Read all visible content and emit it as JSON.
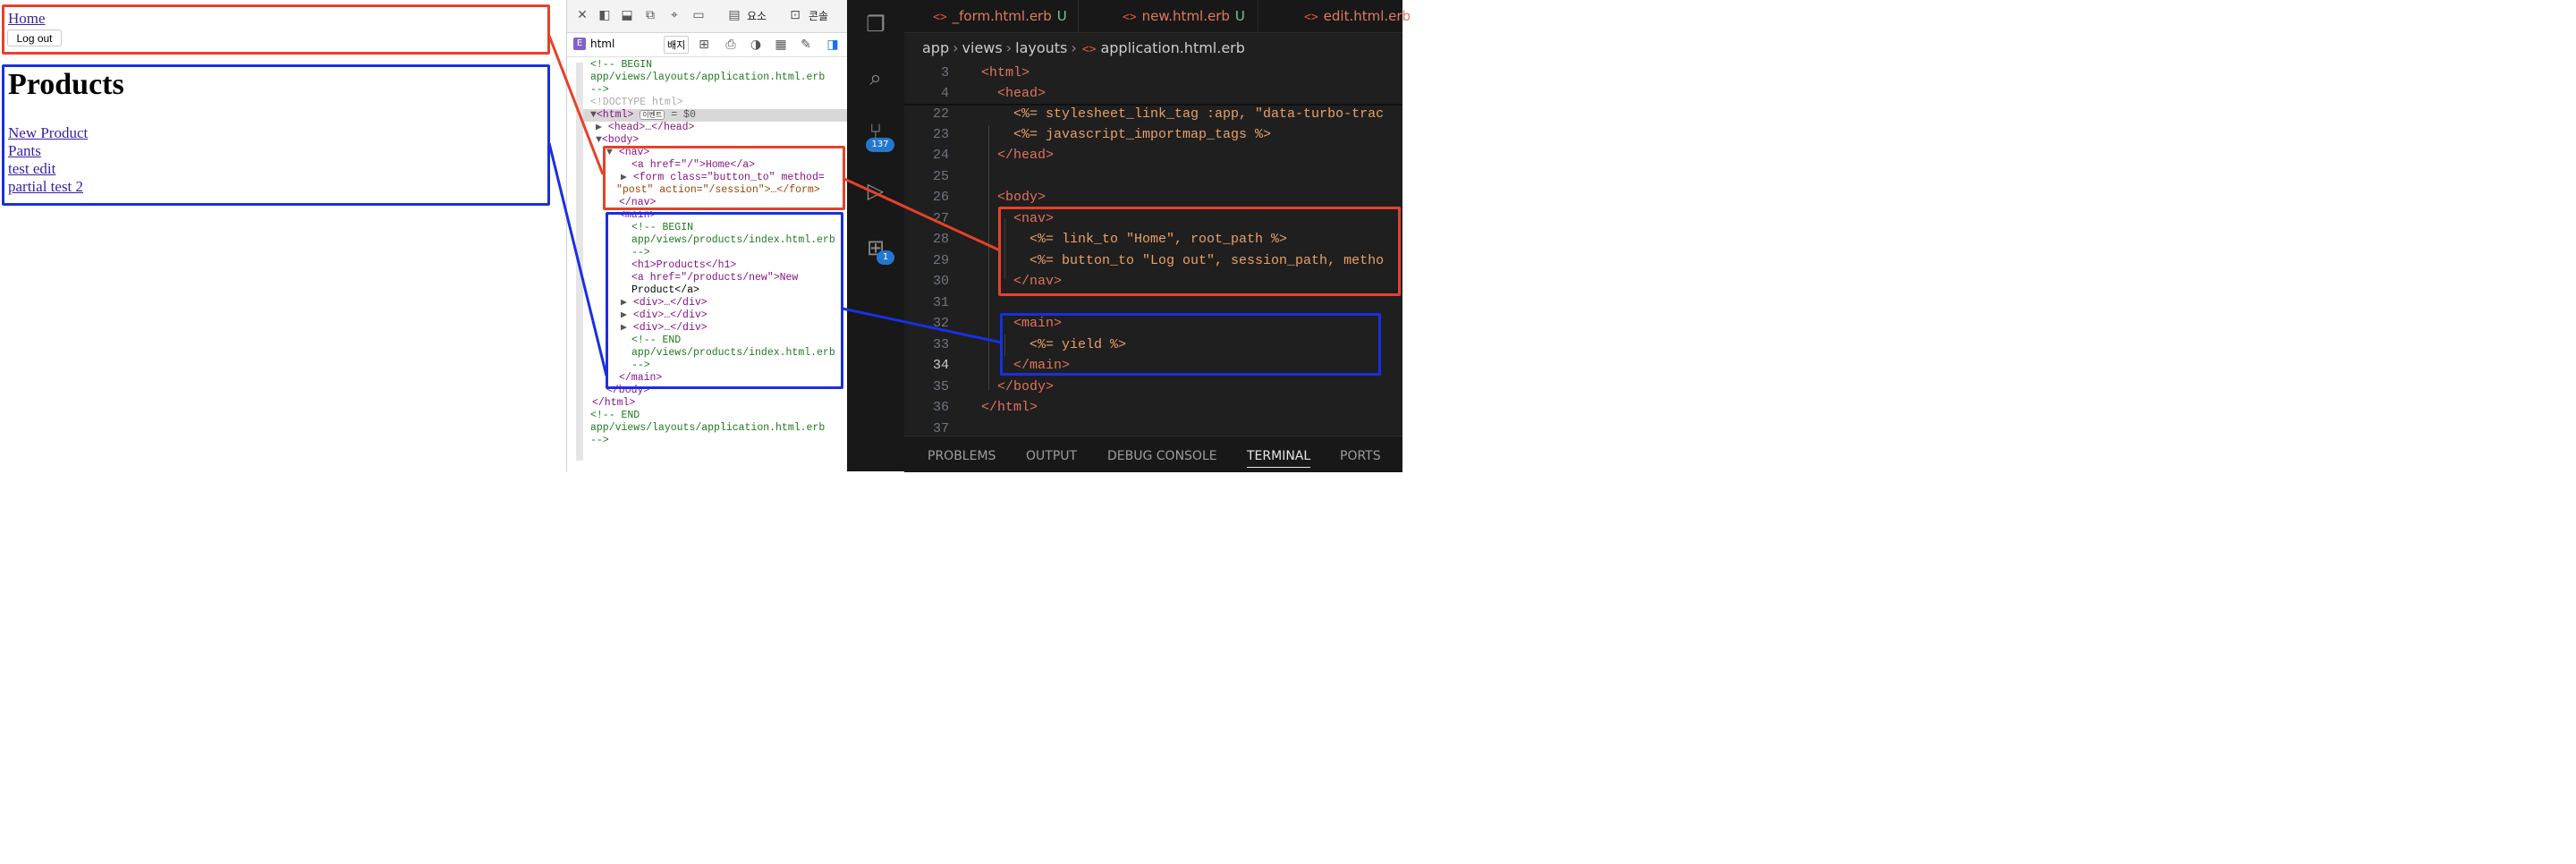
{
  "browser": {
    "nav": {
      "home_link": "Home",
      "logout_button": "Log out"
    },
    "main": {
      "heading": "Products",
      "new_product_link": "New Product",
      "products": [
        "Pants",
        "test edit",
        "partial test 2"
      ]
    }
  },
  "devtools": {
    "tabs": {
      "elements": "요소",
      "console": "콘솔"
    },
    "element_label": "html",
    "badge_button": "배지",
    "event_badge": "이벤트",
    "dollar0": "= $0",
    "tree": [
      "<!-- BEGIN",
      "app/views/layouts/application.html.erb",
      "-->",
      "<!DOCTYPE html>",
      "<html>",
      "<head>…</head>",
      "<body>",
      "<nav>",
      "<a href=\"/\">Home</a>",
      "<form class=\"button_to\" method=",
      "\"post\" action=\"/session\">…</form>",
      "</nav>",
      "<main>",
      "<!-- BEGIN",
      "app/views/products/index.html.erb",
      "-->",
      "<h1>Products</h1>",
      "<a href=\"/products/new\">New",
      "Product</a>",
      "<div>…</div>",
      "<div>…</div>",
      "<div>…</div>",
      "<!-- END",
      "app/views/products/index.html.erb",
      "-->",
      "</main>",
      "</body>",
      "</html>",
      "<!-- END",
      "app/views/layouts/application.html.erb",
      "-->"
    ]
  },
  "vscode": {
    "tabs": [
      {
        "name": "_form.html.erb",
        "status": "U"
      },
      {
        "name": "new.html.erb",
        "status": "U"
      },
      {
        "name": "edit.html.erb",
        "status": ""
      }
    ],
    "breadcrumb": [
      "app",
      "views",
      "layouts",
      "application.html.erb"
    ],
    "source_control_badge": "137",
    "run_badge": "1",
    "lines": [
      {
        "n": "3",
        "text": "<html>"
      },
      {
        "n": "4",
        "text": "  <head>"
      },
      {
        "n": "22",
        "text": "    <%= stylesheet_link_tag :app, \"data-turbo-trac"
      },
      {
        "n": "23",
        "text": "    <%= javascript_importmap_tags %>"
      },
      {
        "n": "24",
        "text": "  </head>"
      },
      {
        "n": "25",
        "text": ""
      },
      {
        "n": "26",
        "text": "  <body>"
      },
      {
        "n": "27",
        "text": "    <nav>"
      },
      {
        "n": "28",
        "text": "      <%= link_to \"Home\", root_path %>"
      },
      {
        "n": "29",
        "text": "      <%= button_to \"Log out\", session_path, metho"
      },
      {
        "n": "30",
        "text": "    </nav>"
      },
      {
        "n": "31",
        "text": ""
      },
      {
        "n": "32",
        "text": "    <main>"
      },
      {
        "n": "33",
        "text": "      <%= yield %>"
      },
      {
        "n": "34",
        "text": "    </main>"
      },
      {
        "n": "35",
        "text": "  </body>"
      },
      {
        "n": "36",
        "text": "</html>"
      },
      {
        "n": "37",
        "text": ""
      }
    ],
    "panel_tabs": [
      "PROBLEMS",
      "OUTPUT",
      "DEBUG CONSOLE",
      "TERMINAL",
      "PORTS"
    ],
    "active_panel_tab": "TERMINAL"
  },
  "colors": {
    "nav_highlight": "#e8402a",
    "main_highlight": "#1a2fe0"
  }
}
